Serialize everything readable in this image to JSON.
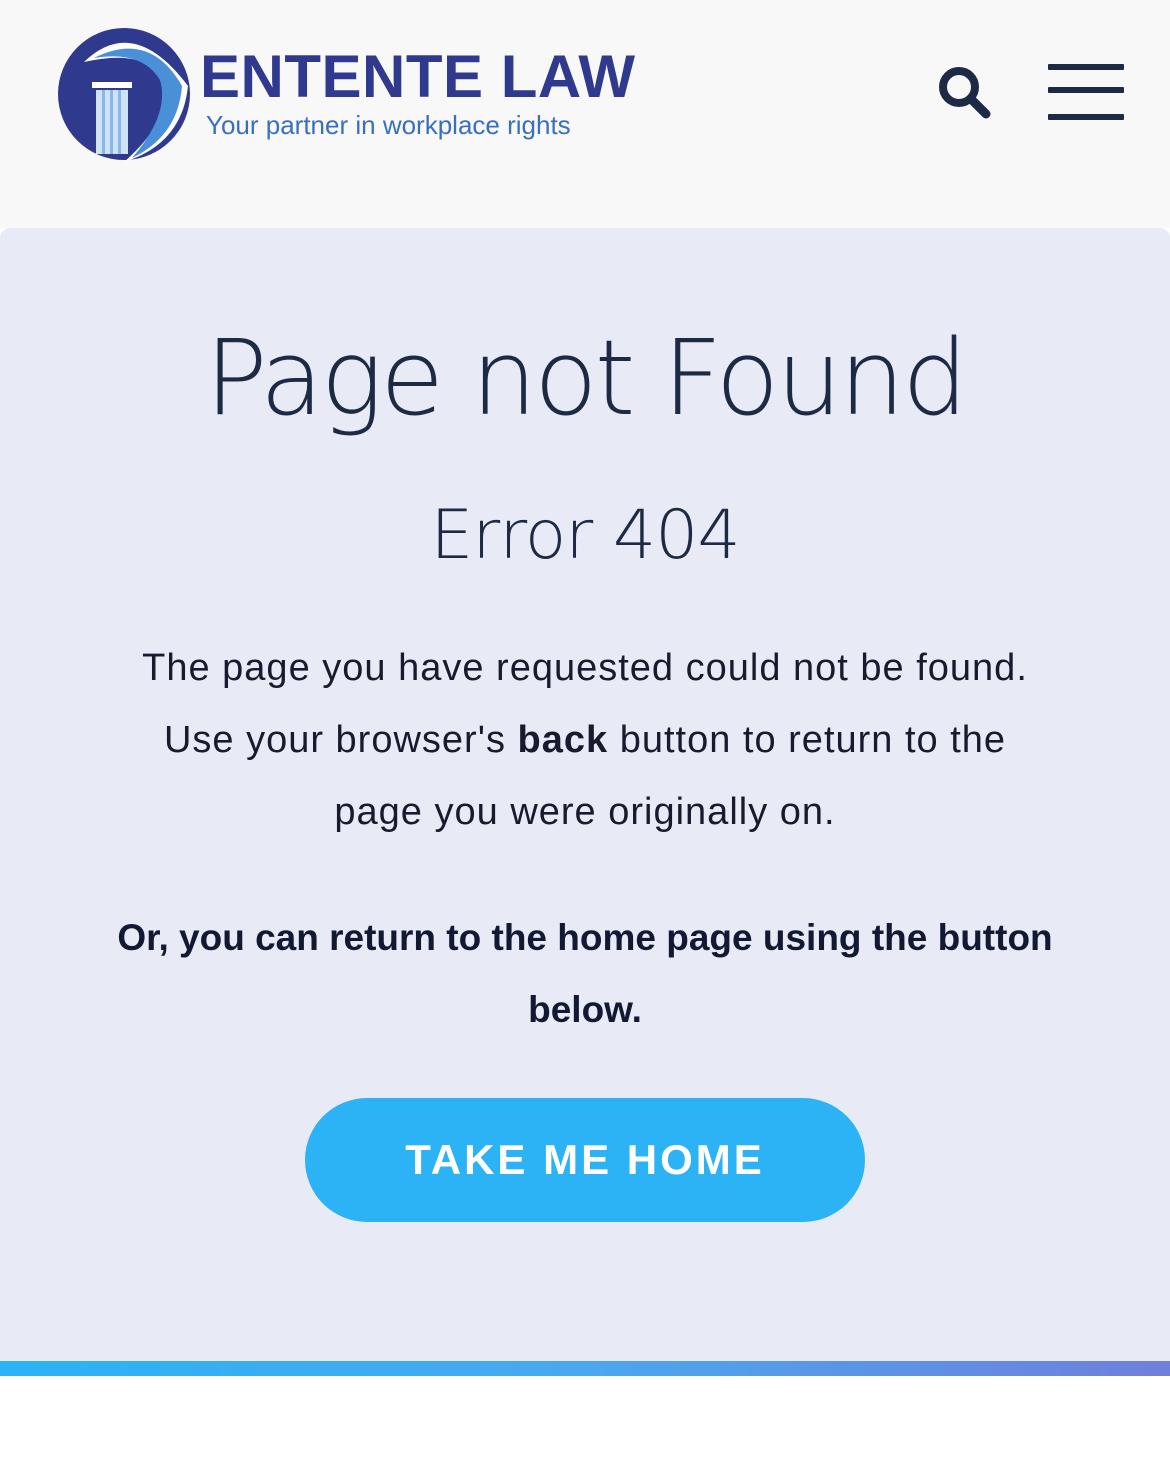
{
  "brand": {
    "name": "ENTENTE LAW",
    "tagline": "Your partner in workplace rights",
    "logo_icon": "column-arc-logo",
    "colors": {
      "primary": "#2f3a8f",
      "accent": "#2bb3f5",
      "text": "#1d2a44"
    }
  },
  "header": {
    "search_icon": "search-icon",
    "menu_icon": "hamburger-menu-icon"
  },
  "error": {
    "title": "Page not Found",
    "code_label": "Error 404",
    "message_before": "The page you have requested could not be found. Use your browser's ",
    "message_bold": "back",
    "message_after": " button to return to the page you were originally on.",
    "cta_text": "Or, you can return to the home page using the button below.",
    "button_label": "TAKE ME HOME"
  }
}
